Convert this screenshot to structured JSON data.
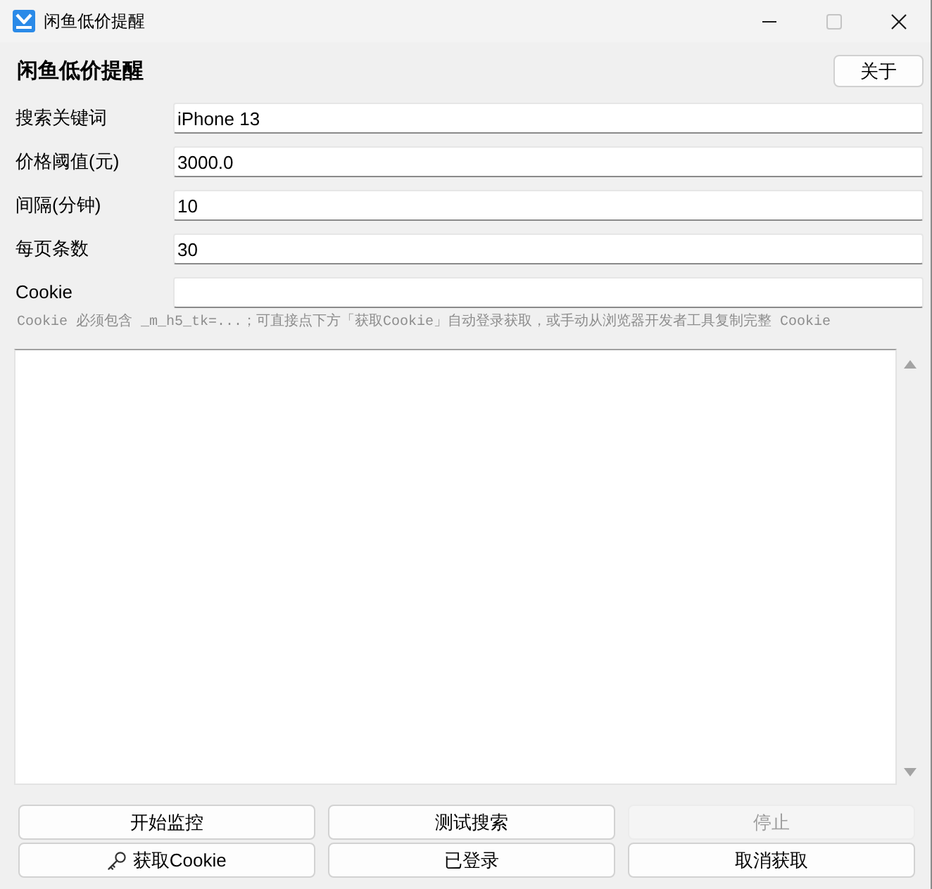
{
  "window": {
    "title": "闲鱼低价提醒",
    "controls": [
      {
        "kind": "minimize",
        "disabled": false
      },
      {
        "kind": "maximize",
        "disabled": true
      },
      {
        "kind": "close",
        "disabled": false
      }
    ]
  },
  "header": {
    "title": "闲鱼低价提醒",
    "about_button": "关于"
  },
  "fields": [
    {
      "label": "搜索关键词",
      "value": "iPhone 13"
    },
    {
      "label": "价格阈值(元)",
      "value": "3000.0"
    },
    {
      "label": "间隔(分钟)",
      "value": "10"
    },
    {
      "label": "每页条数",
      "value": "30"
    },
    {
      "label": "Cookie"
    }
  ],
  "hint": "Cookie 必须包含 _m_h5_tk=...；可直接点下方「获取Cookie」自动登录获取，或手动从浏览器开发者工具复制完整 Cookie",
  "buttons": [
    {
      "label": "开始监控",
      "kind": "text",
      "disabled": false
    },
    {
      "label": "测试搜索",
      "kind": "text",
      "disabled": false
    },
    {
      "label": "停止",
      "kind": "text",
      "disabled": true
    },
    {
      "label": "获取Cookie",
      "kind": "icon",
      "disabled": false
    },
    {
      "label": "已登录",
      "kind": "text",
      "disabled": false
    },
    {
      "label": "取消获取",
      "kind": "text",
      "disabled": false
    }
  ]
}
